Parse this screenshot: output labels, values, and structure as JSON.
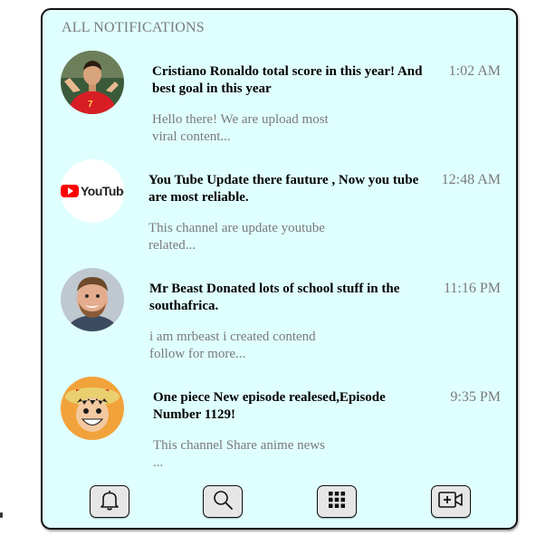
{
  "header": {
    "title": "ALL NOTIFICATIONS"
  },
  "notifications": [
    {
      "avatar_icon": "ronaldo-avatar",
      "title": "Cristiano Ronaldo total score in this year! And best goal in this year",
      "time": "1:02 AM",
      "body": "Hello there! We are upload most viral content..."
    },
    {
      "avatar_icon": "youtube-logo",
      "avatar_text": "YouTube",
      "title": "You Tube Update there fauture , Now you tube are most reliable.",
      "time": "12:48 AM",
      "body": "This channel are update youtube related..."
    },
    {
      "avatar_icon": "mrbeast-avatar",
      "title": "Mr Beast Donated lots of school stuff in the southafrica.",
      "time": "11:16 PM",
      "body": "i am mrbeast i created contend follow for more..."
    },
    {
      "avatar_icon": "luffy-avatar",
      "title": "One piece New episode realesed,Episode Number 1129!",
      "time": "9:35 PM",
      "body": "This channel Share anime news ..."
    }
  ],
  "bottom_nav": [
    {
      "icon": "bell-icon"
    },
    {
      "icon": "search-icon"
    },
    {
      "icon": "grid-icon"
    },
    {
      "icon": "add-video-icon"
    }
  ],
  "colors": {
    "panel_background": "#dffffe",
    "muted_text": "#7a7a7a",
    "youtube_red": "#ff0000"
  }
}
